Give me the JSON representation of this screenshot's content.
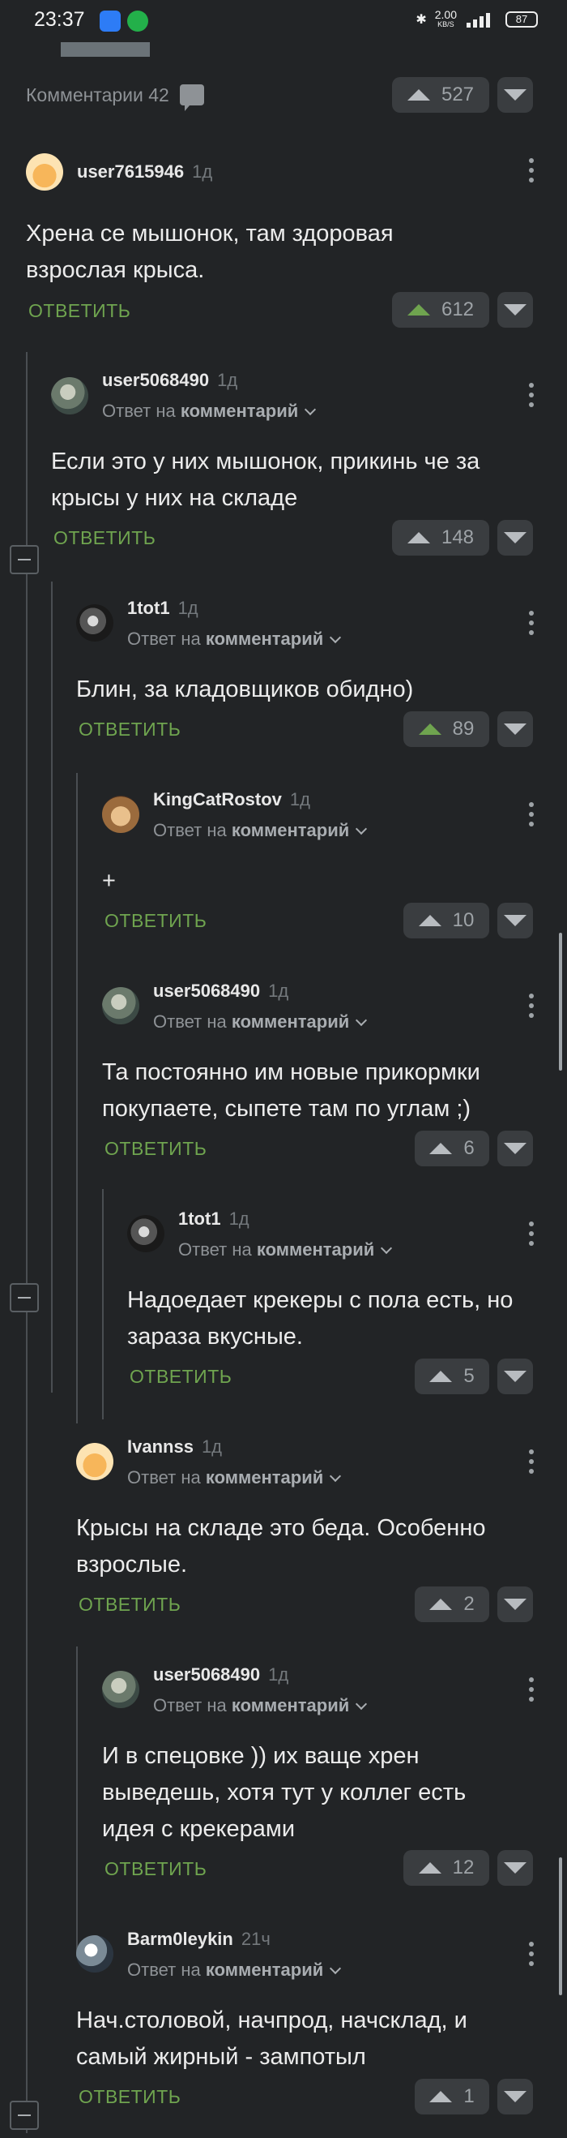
{
  "status_bar": {
    "time": "23:37",
    "net_speed": "2.00",
    "net_unit": "KB/S",
    "battery": "87"
  },
  "header": {
    "comments_label": "Комментарии 42",
    "votes_up": "527"
  },
  "reply_label": "ОТВЕТИТЬ",
  "reply_to_prefix": "Ответ на",
  "reply_to_target": "комментарий",
  "comments": [
    {
      "user": "user7615946",
      "age": "1д",
      "text": "Хрена се мышонок, там здоровая взрослая крыса.",
      "votes": "612"
    },
    {
      "user": "user5068490",
      "age": "1д",
      "text": "Если это у них мышонок, прикинь че за крысы у них на складе",
      "votes": "148"
    },
    {
      "user": "1tot1",
      "age": "1д",
      "text": "Блин, за кладовщиков обидно)",
      "votes": "89"
    },
    {
      "user": "KingCatRostov",
      "age": "1д",
      "text": "+",
      "votes": "10"
    },
    {
      "user": "user5068490",
      "age": "1д",
      "text": "Та постоянно им новые прикормки покупаете, сыпете там по углам ;)",
      "votes": "6"
    },
    {
      "user": "1tot1",
      "age": "1д",
      "text": "Надоедает крекеры с пола есть, но зараза вкусные.",
      "votes": "5"
    },
    {
      "user": "Ivannss",
      "age": "1д",
      "text": "Крысы на складе это беда. Особенно взрослые.",
      "votes": "2"
    },
    {
      "user": "user5068490",
      "age": "1д",
      "text": "И в спецовке )) их ваще хрен выведешь, хотя тут у коллег есть идея с крекерами",
      "votes": "12"
    },
    {
      "user": "Barm0leykin",
      "age": "21ч",
      "text": "Нач.столовой, начпрод, начсклад, и самый жирный - зампотыл",
      "votes": "1"
    }
  ]
}
